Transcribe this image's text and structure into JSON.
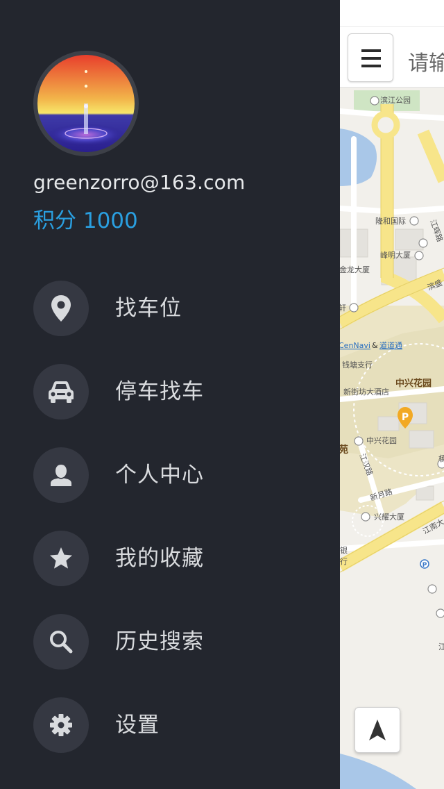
{
  "user": {
    "email": "greenzorro@163.com",
    "points_label": "积分 1000"
  },
  "menu": [
    {
      "label": "找车位",
      "icon": "location-pin-icon"
    },
    {
      "label": "停车找车",
      "icon": "car-icon"
    },
    {
      "label": "个人中心",
      "icon": "user-icon"
    },
    {
      "label": "我的收藏",
      "icon": "star-icon"
    },
    {
      "label": "历史搜索",
      "icon": "search-icon"
    },
    {
      "label": "设置",
      "icon": "gear-icon"
    }
  ],
  "search": {
    "placeholder": "请输"
  },
  "map": {
    "labels": {
      "binjiang_park": "滨江公园",
      "longhe": "隆和国际",
      "fengming": "峰明大厦",
      "jinlong": "金龙大厦",
      "xuan": "轩",
      "cennavi": "CenNavi",
      "amp": "&",
      "daodaotong": "道道通",
      "gongtang": "钱塘支行",
      "xinjiefang": "新街坊大酒店",
      "zhongxing_big": "中兴花园",
      "zhongxing_small": "中兴花园",
      "yuan": "苑",
      "jianghan": "江汉路",
      "xinyue": "新月路",
      "xingyao": "兴耀大厦",
      "jiangnan": "江南大",
      "yin": "银",
      "hang": "行",
      "jiangxu": "江晖路",
      "binsheng": "滨盛",
      "jiang_v": "江",
      "yang": "杨"
    },
    "parking_marker": "P"
  },
  "colors": {
    "drawer_bg": "#23262e",
    "accent_blue": "#2a9fe0",
    "icon_circle": "#353842",
    "road_yellow": "#f7e58a",
    "water": "#a9c7e8"
  }
}
